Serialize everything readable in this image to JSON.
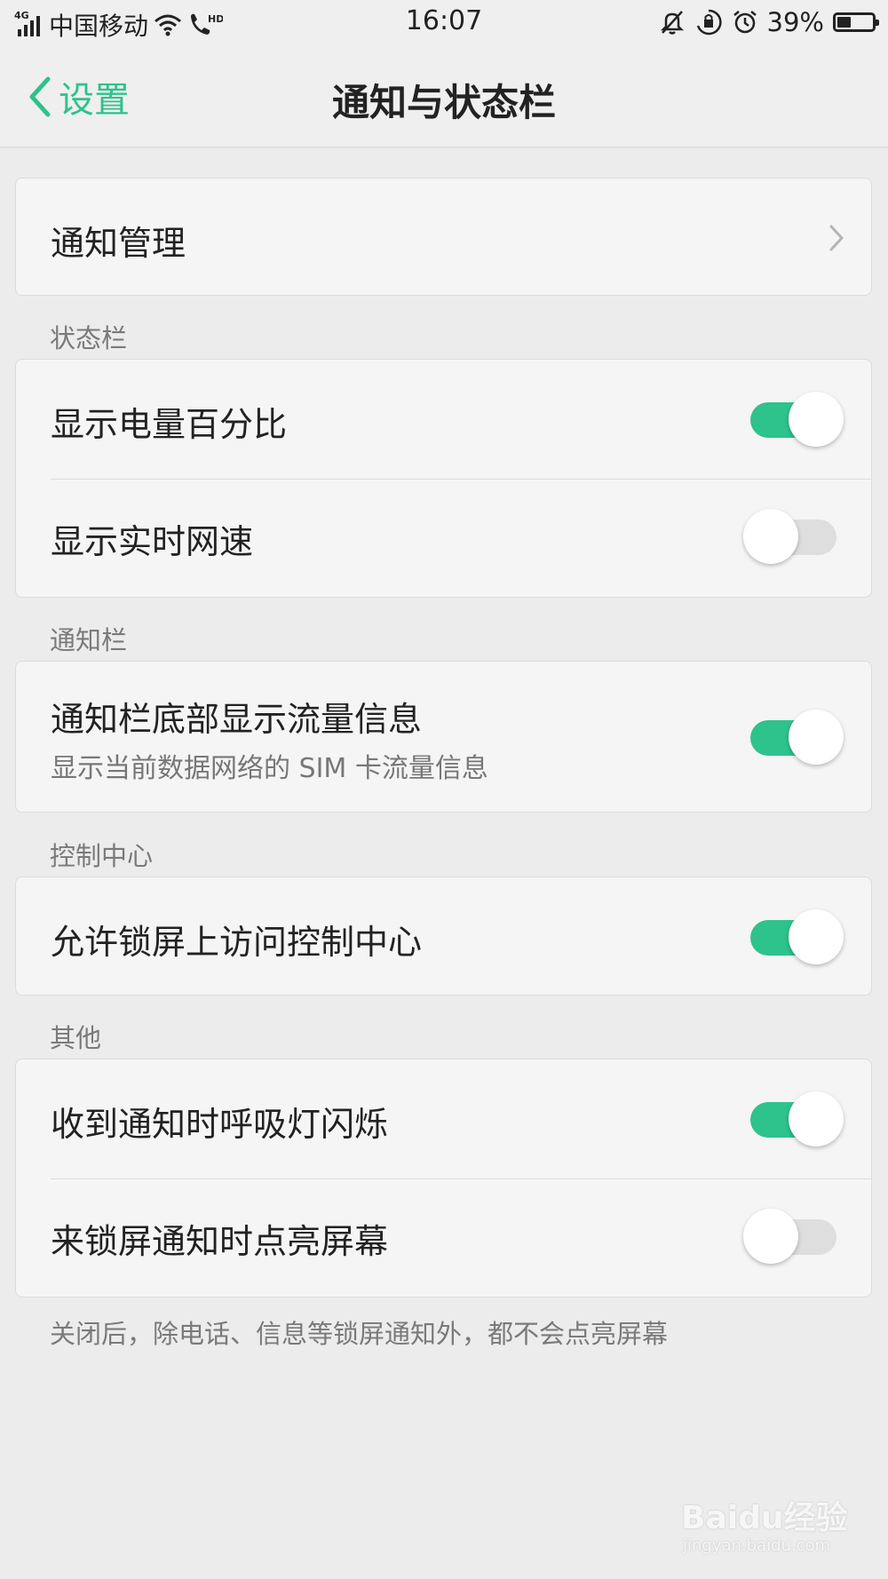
{
  "status_bar": {
    "network": "4G",
    "carrier": "中国移动",
    "time": "16:07",
    "battery_percent": "39%",
    "battery_level": 0.39,
    "icons": [
      "signal-icon",
      "wifi-icon",
      "hd-call-icon",
      "silent-bell-icon",
      "rotation-lock-icon",
      "alarm-icon",
      "battery-icon"
    ]
  },
  "nav": {
    "back_label": "设置",
    "title": "通知与状态栏"
  },
  "colors": {
    "accent": "#2ec28c",
    "background": "#ececec",
    "card": "#f5f5f5"
  },
  "cards": {
    "notification_manage": {
      "label": "通知管理"
    },
    "status_bar": {
      "header": "状态栏",
      "battery_percent": {
        "label": "显示电量百分比",
        "on": true
      },
      "network_speed": {
        "label": "显示实时网速",
        "on": false
      }
    },
    "notification_bar": {
      "header": "通知栏",
      "data_usage": {
        "label": "通知栏底部显示流量信息",
        "sub": "显示当前数据网络的 SIM 卡流量信息",
        "on": true
      }
    },
    "control_center": {
      "header": "控制中心",
      "lockscreen_access": {
        "label": "允许锁屏上访问控制中心",
        "on": true
      }
    },
    "other": {
      "header": "其他",
      "breathing_light": {
        "label": "收到通知时呼吸灯闪烁",
        "on": true
      },
      "wake_screen": {
        "label": "来锁屏通知时点亮屏幕",
        "on": false
      },
      "footnote": "关闭后，除电话、信息等锁屏通知外，都不会点亮屏幕"
    }
  },
  "watermark": {
    "logo": "Baidu经验",
    "url": "jingyan.baidu.com"
  }
}
